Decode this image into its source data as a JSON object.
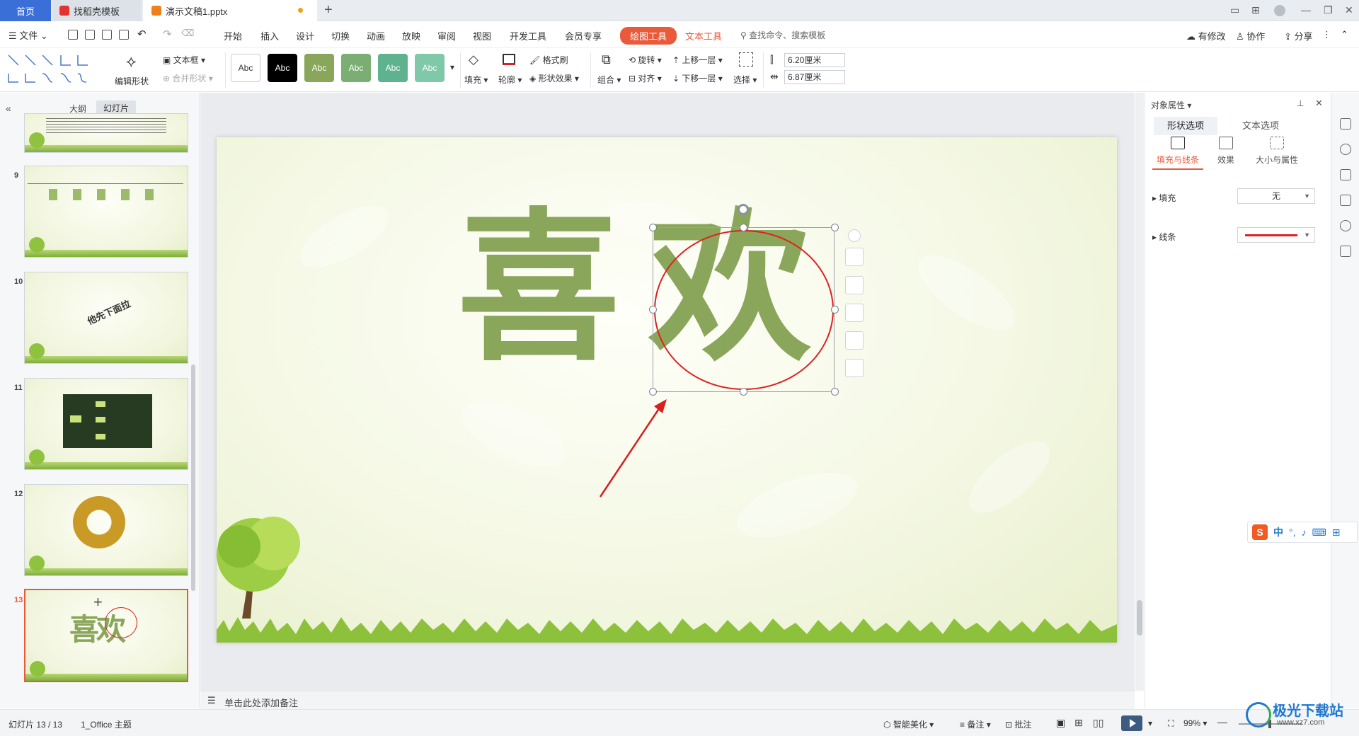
{
  "titlebar": {
    "tabs": [
      {
        "label": "首页"
      },
      {
        "label": "找稻壳模板"
      },
      {
        "label": "演示文稿1.pptx"
      }
    ]
  },
  "menubar": {
    "file": "文件",
    "items": [
      "开始",
      "插入",
      "设计",
      "切换",
      "动画",
      "放映",
      "审阅",
      "视图",
      "开发工具",
      "会员专享"
    ],
    "drawing_tools": "绘图工具",
    "text_tools": "文本工具",
    "search_placeholder": "查找命令、搜索模板",
    "has_changes": "有修改",
    "collaborate": "协作",
    "share": "分享"
  },
  "ribbon": {
    "edit_shape": "编辑形状",
    "text_box": "文本框",
    "merge_shape": "合并形状",
    "style_label": "Abc",
    "style_colors": [
      "#ffffff",
      "#000000",
      "#8aa65a",
      "#7aae72",
      "#5fb28e",
      "#7fc8a8"
    ],
    "fill": "填充",
    "outline": "轮廓",
    "format_painter": "格式刷",
    "shape_effects": "形状效果",
    "group": "组合",
    "rotate": "旋转",
    "align": "对齐",
    "bring_forward": "上移一层",
    "send_backward": "下移一层",
    "select": "选择",
    "height": "6.20厘米",
    "width": "6.87厘米"
  },
  "leftpanel": {
    "outline_tab": "大纲",
    "slides_tab": "幻灯片",
    "slides": [
      {
        "num": "9"
      },
      {
        "num": "10",
        "text": "他先下面拉"
      },
      {
        "num": "11"
      },
      {
        "num": "12"
      },
      {
        "num": "13",
        "text": "喜欢"
      }
    ]
  },
  "slide": {
    "char1": "喜",
    "char2": "欢"
  },
  "notes": {
    "placeholder": "单击此处添加备注"
  },
  "properties": {
    "title": "对象属性",
    "tab_shape": "形状选项",
    "tab_text": "文本选项",
    "sub_fill_line": "填充与线条",
    "sub_effects": "效果",
    "sub_size": "大小与属性",
    "fill_label": "填充",
    "fill_value": "无",
    "line_label": "线条",
    "line_color": "#e02020"
  },
  "ime": {
    "lang": "中",
    "punct": "°,"
  },
  "status": {
    "slide_count": "幻灯片 13 / 13",
    "theme": "1_Office 主题",
    "beautify": "智能美化",
    "notes": "备注",
    "comments": "批注",
    "zoom": "99%"
  },
  "watermark": {
    "title": "极光下载站",
    "url": "www.xz7.com"
  }
}
